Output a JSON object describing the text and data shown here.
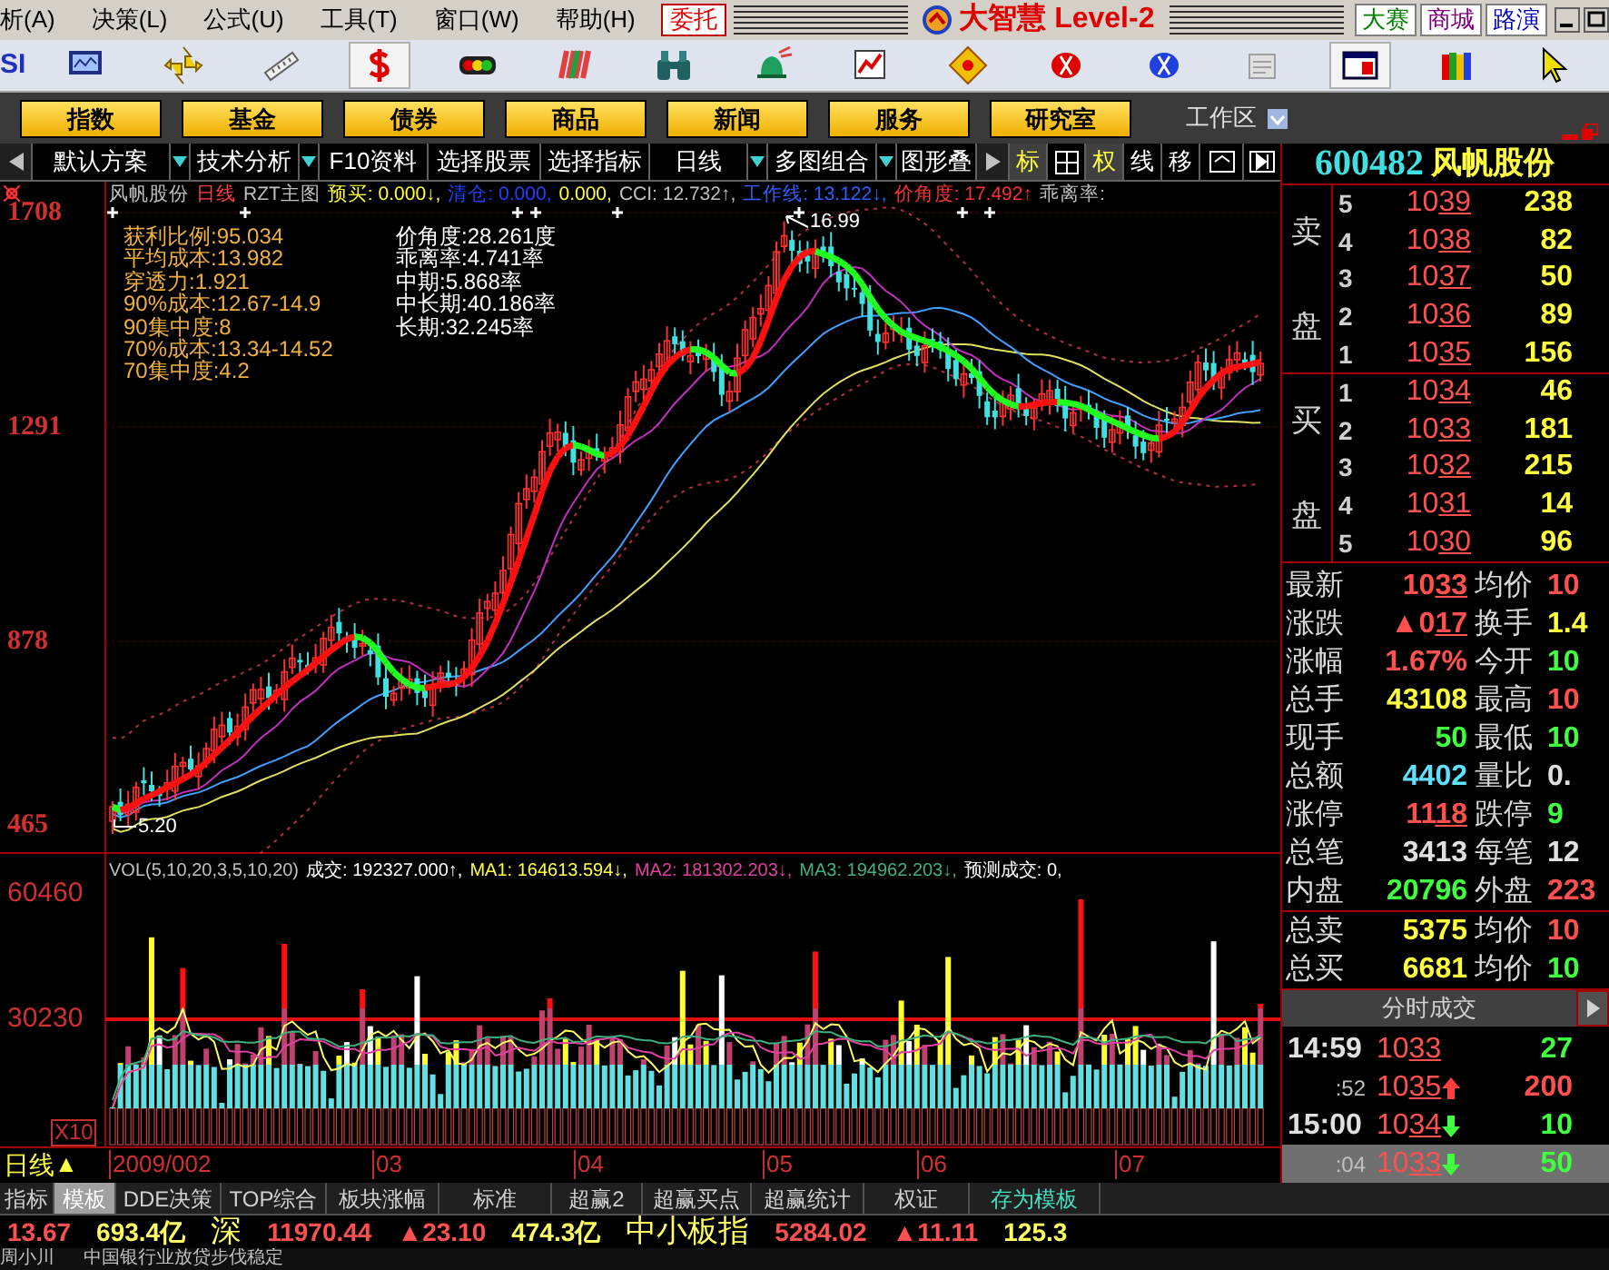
{
  "menu": [
    "析(A)",
    "决策(L)",
    "公式(U)",
    "工具(T)",
    "窗口(W)",
    "帮助(H)"
  ],
  "trade_button": "委托",
  "window_title": "大智慧 Level-2",
  "header_links": [
    {
      "label": "大赛",
      "color": "#008000"
    },
    {
      "label": "商城",
      "color": "#800080"
    },
    {
      "label": "路演",
      "color": "#0000c0"
    }
  ],
  "toolbar_label": "SI",
  "toolbar_buttons": [
    {
      "kind": "panel",
      "selected": false
    },
    {
      "kind": "move",
      "selected": false
    },
    {
      "kind": "ruler",
      "selected": false
    },
    {
      "kind": "dollar",
      "selected": true
    },
    {
      "kind": "lights",
      "selected": false
    },
    {
      "kind": "stripes",
      "selected": false
    },
    {
      "kind": "binoculars",
      "selected": false
    },
    {
      "kind": "bell",
      "selected": false
    },
    {
      "kind": "chart",
      "selected": false
    },
    {
      "kind": "diamond",
      "selected": false
    },
    {
      "kind": "red-coin",
      "selected": false
    },
    {
      "kind": "blue-coin",
      "selected": false
    },
    {
      "kind": "notepad",
      "selected": false
    },
    {
      "kind": "window",
      "selected": true
    },
    {
      "kind": "books",
      "selected": false
    },
    {
      "kind": "cursor",
      "selected": false
    }
  ],
  "category_buttons": [
    "指数",
    "基金",
    "债券",
    "商品",
    "新闻",
    "服务",
    "研究室"
  ],
  "workspace": {
    "label": "工作区",
    "checked": true
  },
  "chart_tabs": [
    {
      "label": "默认方案",
      "dropdown": true
    },
    {
      "label": "技术分析",
      "dropdown": true
    },
    {
      "label": "F10资料",
      "dropdown": false
    },
    {
      "label": "选择股票",
      "dropdown": false
    },
    {
      "label": "选择指标",
      "dropdown": false
    },
    {
      "label": "日线",
      "dropdown": true
    },
    {
      "label": "多图组合",
      "dropdown": true
    },
    {
      "label": "图形叠",
      "dropdown": false
    }
  ],
  "tool_tabs": [
    {
      "label": "标",
      "selected": true
    },
    {
      "kind": "grid",
      "selected": false
    },
    {
      "label": "权",
      "selected": true
    },
    {
      "label": "线",
      "selected": false
    },
    {
      "label": "移",
      "selected": false
    }
  ],
  "stock": {
    "code": "600482",
    "name": "风帆股份"
  },
  "chart_legend": [
    {
      "text": "风帆股份",
      "color": "#c0c0c0"
    },
    {
      "text": "日线",
      "color": "#ff4040"
    },
    {
      "text": "RZT主图",
      "color": "#c0c0c0"
    },
    {
      "text": "预买: 0.000↓,",
      "color": "#ffff40"
    },
    {
      "text": "清仓: 0.000,",
      "color": "#2040ff"
    },
    {
      "text": "0.000,",
      "color": "#ffff40"
    },
    {
      "text": "CCI: 12.732↑,",
      "color": "#c0c0c0"
    },
    {
      "text": "工作线: 13.122↓,",
      "color": "#3060ff"
    },
    {
      "text": "价角度: 17.492↑",
      "color": "#ff3030"
    },
    {
      "text": "乖离率:",
      "color": "#c0c0c0"
    }
  ],
  "chip_stats": [
    "获利比例:95.034",
    "平均成本:13.982",
    "穿透力:1.921",
    "90%成本:12.67-14.9",
    "90集中度:8",
    "70%成本:13.34-14.52",
    "70集中度:4.2"
  ],
  "angle_stats": [
    "价角度:28.261度",
    "乖离率:4.741率",
    "中期:5.868率",
    "中长期:40.186率",
    "长期:32.245率"
  ],
  "price_axis": [
    "1708",
    "1291",
    "878",
    "465"
  ],
  "high_label": "16.99",
  "low_label": "5.20",
  "volume_legend": [
    {
      "text": "VOL(5,10,20,3,5,10,20)",
      "color": "#c0c0c0"
    },
    {
      "text": "成交: 192327.000↑,",
      "color": "#ffffff"
    },
    {
      "text": "MA1: 164613.594↓,",
      "color": "#ffff40"
    },
    {
      "text": "MA2: 181302.203↓,",
      "color": "#e040a0"
    },
    {
      "text": "MA3: 194962.203↓,",
      "color": "#40b080"
    },
    {
      "text": "预测成交: 0,",
      "color": "#ffffff"
    }
  ],
  "volume_axis": [
    "60460",
    "30230"
  ],
  "volume_unit": "X10",
  "period": {
    "label": "日线",
    "marker": "▲"
  },
  "x_axis": [
    "2009/002",
    "03",
    "04",
    "05",
    "06",
    "07"
  ],
  "bottom_tabs": [
    {
      "label": "指标",
      "selected": false,
      "kind": "tab"
    },
    {
      "label": "模板",
      "selected": true,
      "kind": "tab"
    },
    {
      "label": "DDE决策",
      "selected": false,
      "kind": "tab"
    },
    {
      "label": "TOP综合",
      "selected": false,
      "kind": "tab"
    },
    {
      "label": "板块涨幅",
      "selected": false,
      "kind": "tab"
    },
    {
      "label": "标准",
      "selected": false,
      "kind": "tab"
    },
    {
      "label": "超赢2",
      "selected": false,
      "kind": "tab"
    },
    {
      "label": "超赢买点",
      "selected": false,
      "kind": "tab"
    },
    {
      "label": "超赢统计",
      "selected": false,
      "kind": "tab"
    },
    {
      "label": "权证",
      "selected": false,
      "kind": "tab"
    },
    {
      "label": "存为模板",
      "selected": false,
      "kind": "action"
    }
  ],
  "ticker": [
    {
      "text": "13.67",
      "kind": "value",
      "color": "#ff5050"
    },
    {
      "text": "693.4亿",
      "kind": "value",
      "color": "#ffff60"
    },
    {
      "text": "深",
      "kind": "label",
      "color": "#ffff60"
    },
    {
      "text": "11970.44",
      "kind": "value",
      "color": "#ff5050"
    },
    {
      "text": "▲23.10",
      "kind": "value",
      "color": "#ff5050"
    },
    {
      "text": "474.3亿",
      "kind": "value",
      "color": "#ffff60"
    },
    {
      "text": "中小板指",
      "kind": "label",
      "color": "#ffff60"
    },
    {
      "text": "5284.02",
      "kind": "value",
      "color": "#ff5050"
    },
    {
      "text": "▲11.11",
      "kind": "value",
      "color": "#ff5050"
    },
    {
      "text": "125.3",
      "kind": "value",
      "color": "#ffff60"
    }
  ],
  "news": [
    "周小川",
    "中国银行业放贷步伐稳定"
  ],
  "order_book": {
    "sell_labels": [
      "卖",
      "盘"
    ],
    "buy_labels": [
      "买",
      "盘"
    ],
    "asks": [
      {
        "rank": "5",
        "price": "1039",
        "volume": "238"
      },
      {
        "rank": "4",
        "price": "1038",
        "volume": "82"
      },
      {
        "rank": "3",
        "price": "1037",
        "volume": "50"
      },
      {
        "rank": "2",
        "price": "1036",
        "volume": "89"
      },
      {
        "rank": "1",
        "price": "1035",
        "volume": "156"
      }
    ],
    "bids": [
      {
        "rank": "1",
        "price": "1034",
        "volume": "46"
      },
      {
        "rank": "2",
        "price": "1033",
        "volume": "181"
      },
      {
        "rank": "3",
        "price": "1032",
        "volume": "215"
      },
      {
        "rank": "4",
        "price": "1031",
        "volume": "14"
      },
      {
        "rank": "5",
        "price": "1030",
        "volume": "96"
      }
    ]
  },
  "quote_stats": [
    [
      {
        "label": "最新",
        "value": "1033",
        "color": "#ff5050",
        "kind": "price"
      },
      {
        "label": "均价",
        "value": "10",
        "color": "#ff5050",
        "kind": "plain"
      }
    ],
    [
      {
        "label": "涨跌",
        "value": "▲017",
        "color": "#ff5050",
        "kind": "price"
      },
      {
        "label": "换手",
        "value": "1.4",
        "color": "#ffff40",
        "kind": "plain"
      }
    ],
    [
      {
        "label": "涨幅",
        "value": "1.67%",
        "color": "#ff5050",
        "kind": "plain"
      },
      {
        "label": "今开",
        "value": "10",
        "color": "#40ff40",
        "kind": "plain"
      }
    ],
    [
      {
        "label": "总手",
        "value": "43108",
        "color": "#ffff40",
        "kind": "plain"
      },
      {
        "label": "最高",
        "value": "10",
        "color": "#ff5050",
        "kind": "plain"
      }
    ],
    [
      {
        "label": "现手",
        "value": "50",
        "color": "#40ff40",
        "kind": "plain"
      },
      {
        "label": "最低",
        "value": "10",
        "color": "#40ff40",
        "kind": "plain"
      }
    ],
    [
      {
        "label": "总额",
        "value": "4402",
        "color": "#60e0ff",
        "kind": "plain"
      },
      {
        "label": "量比",
        "value": "0.",
        "color": "#e0e0e0",
        "kind": "plain"
      }
    ],
    [
      {
        "label": "涨停",
        "value": "1118",
        "color": "#ff5050",
        "kind": "price"
      },
      {
        "label": "跌停",
        "value": "9",
        "color": "#40ff40",
        "kind": "plain"
      }
    ],
    [
      {
        "label": "总笔",
        "value": "3413",
        "color": "#e0e0e0",
        "kind": "plain"
      },
      {
        "label": "每笔",
        "value": "12",
        "color": "#e0e0e0",
        "kind": "plain"
      }
    ],
    [
      {
        "label": "内盘",
        "value": "20796",
        "color": "#40ff40",
        "kind": "plain"
      },
      {
        "label": "外盘",
        "value": "223",
        "color": "#ff5050",
        "kind": "plain"
      }
    ]
  ],
  "order_totals": [
    [
      {
        "label": "总卖",
        "value": "5375",
        "color": "#ffff40"
      },
      {
        "label": "均价",
        "value": "10",
        "color": "#ff5050"
      }
    ],
    [
      {
        "label": "总买",
        "value": "6681",
        "color": "#ffff40"
      },
      {
        "label": "均价",
        "value": "10",
        "color": "#40ff40"
      }
    ]
  ],
  "trades_header": "分时成交",
  "trades": [
    {
      "time": "14:59",
      "kind": "minute",
      "price": "1033",
      "rising": false,
      "falling": false,
      "volume": "27",
      "color": "#40ff40",
      "selected": false
    },
    {
      "time": ":52",
      "kind": "second",
      "price": "1035",
      "rising": true,
      "falling": false,
      "volume": "200",
      "color": "#ff5050",
      "selected": false
    },
    {
      "time": "15:00",
      "kind": "minute",
      "price": "1034",
      "rising": false,
      "falling": true,
      "volume": "10",
      "color": "#40ff40",
      "selected": false
    },
    {
      "time": ":04",
      "kind": "second",
      "price": "1033",
      "rising": false,
      "falling": true,
      "volume": "50",
      "color": "#40ff40",
      "selected": true
    }
  ]
}
